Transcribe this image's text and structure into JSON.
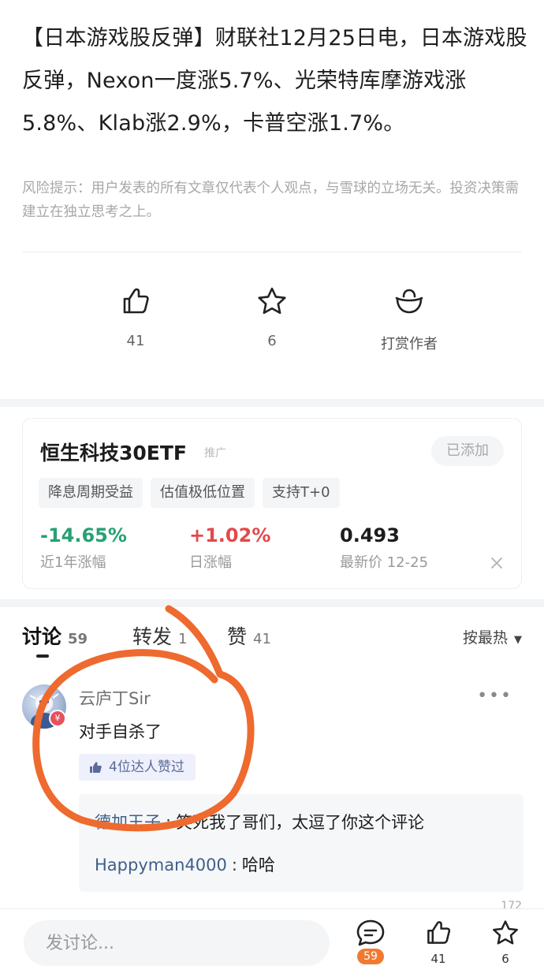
{
  "article": {
    "text": "【日本游戏股反弹】财联社12月25日电，日本游戏股反弹，Nexon一度涨5.7%、光荣特库摩游戏涨5.8%、Klab涨2.9%，卡普空涨1.7%。"
  },
  "risk_notice": "风险提示：用户发表的所有文章仅代表个人观点，与雪球的立场无关。投资决策需建立在独立思考之上。",
  "actions": {
    "like_count": "41",
    "favorite_count": "6",
    "reward_label": "打赏作者"
  },
  "etf": {
    "name": "恒生科技30ETF",
    "promo_tag": "推广",
    "added_label": "已添加",
    "tags": [
      "降息周期受益",
      "估值极低位置",
      "支持T+0"
    ],
    "stats": [
      {
        "value": "-14.65%",
        "label": "近1年涨幅"
      },
      {
        "value": "+1.02%",
        "label": "日涨幅"
      },
      {
        "value": "0.493",
        "label": "最新价 12-25"
      }
    ],
    "colors": {
      "down": "#27a173",
      "up": "#e24a4a"
    }
  },
  "discussion": {
    "tabs": [
      {
        "label": "讨论",
        "count": "59"
      },
      {
        "label": "转发",
        "count": "1"
      },
      {
        "label": "赞",
        "count": "41"
      }
    ],
    "sort_label": "按最热"
  },
  "comment": {
    "user": "云庐丁Sir",
    "body": "对手自杀了",
    "likes_label": "4位达人赞过",
    "avatar_badge": "¥",
    "replies": [
      {
        "user": "德加王子",
        "text": "笑死我了哥们，太逗了你这个评论"
      },
      {
        "user": "Happyman4000",
        "text": "哈哈"
      }
    ],
    "total_replies": "172"
  },
  "bottom_bar": {
    "input_placeholder": "发讨论...",
    "comment_count": "59",
    "like_count": "41",
    "favorite_count": "6"
  },
  "annotation": {
    "color": "#ee6a2e",
    "shape": "hand-drawn circle"
  }
}
